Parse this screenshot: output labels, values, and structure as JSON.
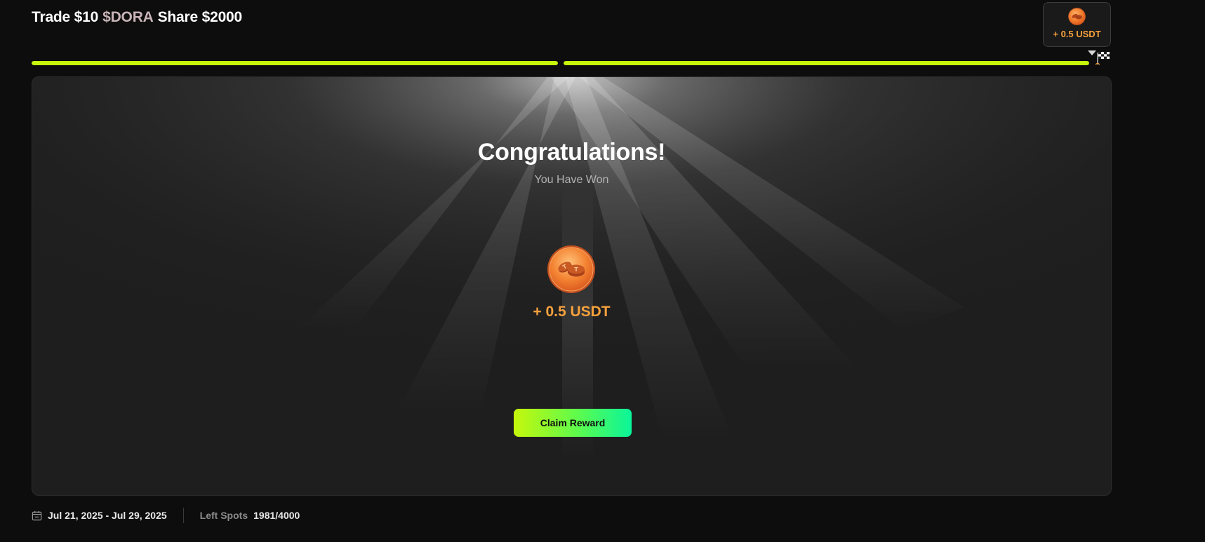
{
  "header": {
    "title_prefix": "Trade $10",
    "title_token": "$DORA",
    "title_suffix": "Share $2000"
  },
  "badge": {
    "coin_icon": "usdt-coin-icon",
    "reward_text": "+ 0.5 USDT"
  },
  "progress": {
    "segments": [
      {
        "fill_fraction": 1.0
      },
      {
        "fill_fraction": 1.0
      }
    ],
    "finish_icon": "checkered-flag-icon"
  },
  "result": {
    "heading": "Congratulations!",
    "subheading": "You Have Won",
    "coin_icon": "usdt-coin-icon",
    "amount": "+ 0.5 USDT",
    "claim_label": "Claim Reward"
  },
  "footer": {
    "calendar_icon": "calendar-icon",
    "date_range": "Jul 21, 2025 - Jul 29, 2025",
    "spots_label": "Left Spots",
    "spots_value": "1981/4000"
  },
  "colors": {
    "accent_lime": "#c6f70b",
    "accent_cyan": "#0af59b",
    "reward_orange": "#f6a13d",
    "token_pink": "#c8b3b8",
    "page_bg": "#0d0d0d",
    "panel_bg": "#1e1e1e"
  }
}
